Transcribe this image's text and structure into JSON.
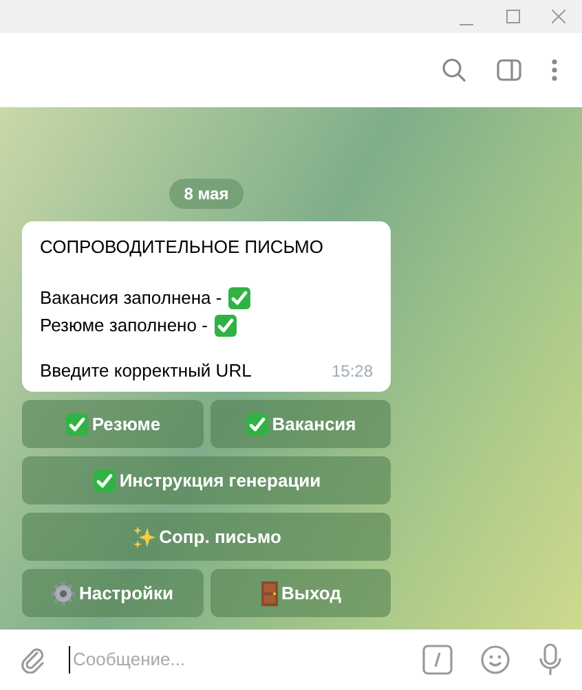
{
  "chat": {
    "date": "8 мая",
    "message": {
      "title": "СОПРОВОДИТЕЛЬНОЕ ПИСЬМО",
      "status_lines": [
        {
          "text": "Вакансия заполнена -",
          "checked": true
        },
        {
          "text": "Резюме заполнено -",
          "checked": true
        }
      ],
      "prompt": "Введите корректный URL",
      "time": "15:28"
    },
    "keyboard": [
      [
        {
          "label": "Резюме",
          "kind": "check"
        },
        {
          "label": "Вакансия",
          "kind": "check"
        }
      ],
      [
        {
          "label": "Инструкция генерации",
          "kind": "check"
        }
      ],
      [
        {
          "label": "Сопр. письмо",
          "kind": "sparkles"
        }
      ],
      [
        {
          "label": "Настройки",
          "kind": "gear"
        },
        {
          "label": "Выход",
          "kind": "door"
        }
      ]
    ]
  },
  "composer": {
    "placeholder": "Сообщение..."
  }
}
